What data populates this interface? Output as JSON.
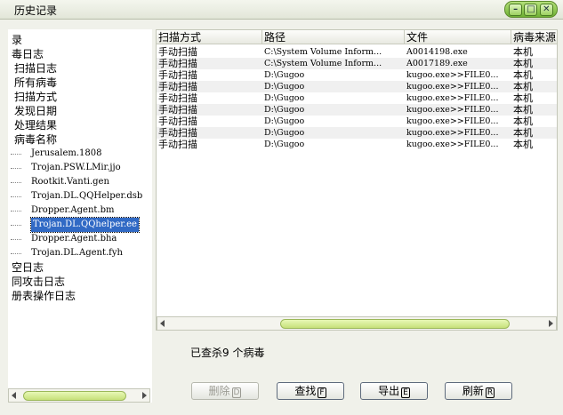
{
  "window": {
    "title": "历史记录",
    "controls": {
      "minimize": "–",
      "maximize": "□",
      "close": "✕"
    }
  },
  "tree": {
    "items": [
      {
        "label": "录",
        "level": 0
      },
      {
        "label": "毒日志",
        "level": 0
      },
      {
        "label": "扫描日志",
        "level": 1
      },
      {
        "label": "所有病毒",
        "level": 1
      },
      {
        "label": "扫描方式",
        "level": 1
      },
      {
        "label": "发现日期",
        "level": 1
      },
      {
        "label": "处理结果",
        "level": 1
      },
      {
        "label": "病毒名称",
        "level": 1
      },
      {
        "label": "Jerusalem.1808",
        "level": 2
      },
      {
        "label": "Trojan.PSW.LMir.jjo",
        "level": 2
      },
      {
        "label": "Rootkit.Vanti.gen",
        "level": 2
      },
      {
        "label": "Trojan.DL.QQHelper.dsb",
        "level": 2
      },
      {
        "label": "Dropper.Agent.bm",
        "level": 2
      },
      {
        "label": "Trojan.DL.QQhelper.ee",
        "level": 2,
        "selected": true
      },
      {
        "label": "Dropper.Agent.bha",
        "level": 2
      },
      {
        "label": "Trojan.DL.Agent.fyh",
        "level": 2
      },
      {
        "label": "空日志",
        "level": 0
      },
      {
        "label": "同攻击日志",
        "level": 0
      },
      {
        "label": "册表操作日志",
        "level": 0
      }
    ]
  },
  "grid": {
    "columns": [
      "扫描方式",
      "路径",
      "文件",
      "病毒来源"
    ],
    "rows": [
      [
        "手动扫描",
        "C:\\System Volume Inform...",
        "A0014198.exe",
        "本机"
      ],
      [
        "手动扫描",
        "C:\\System Volume Inform...",
        "A0017189.exe",
        "本机"
      ],
      [
        "手动扫描",
        "D:\\Gugoo",
        "kugoo.exe>>FILE0...",
        "本机"
      ],
      [
        "手动扫描",
        "D:\\Gugoo",
        "kugoo.exe>>FILE0...",
        "本机"
      ],
      [
        "手动扫描",
        "D:\\Gugoo",
        "kugoo.exe>>FILE0...",
        "本机"
      ],
      [
        "手动扫描",
        "D:\\Gugoo",
        "kugoo.exe>>FILE0...",
        "本机"
      ],
      [
        "手动扫描",
        "D:\\Gugoo",
        "kugoo.exe>>FILE0...",
        "本机"
      ],
      [
        "手动扫描",
        "D:\\Gugoo",
        "kugoo.exe>>FILE0...",
        "本机"
      ],
      [
        "手动扫描",
        "D:\\Gugoo",
        "kugoo.exe>>FILE0...",
        "本机"
      ]
    ]
  },
  "status": {
    "text": "已查杀9 个病毒"
  },
  "buttons": {
    "delete": {
      "label": "删除",
      "key": "D",
      "enabled": false
    },
    "find": {
      "label": "查找",
      "key": "F",
      "enabled": true
    },
    "export": {
      "label": "导出",
      "key": "E",
      "enabled": true
    },
    "refresh": {
      "label": "刷新",
      "key": "R",
      "enabled": true
    }
  },
  "colors": {
    "selection": "#316ac5",
    "scroll_thumb": "#c6e07a",
    "window_buttons": "#6fb133"
  }
}
